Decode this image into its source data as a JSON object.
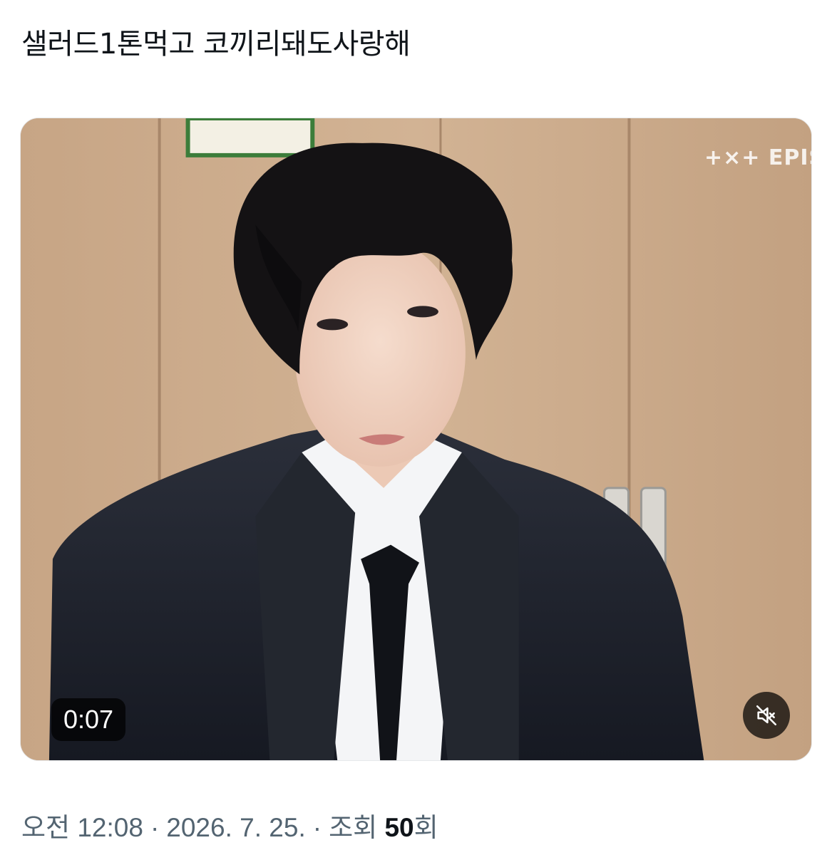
{
  "tweet": {
    "text": "샐러드1톤먹고 코끼리돼도사랑해"
  },
  "media": {
    "type": "video",
    "elapsed_time": "0:07",
    "watermark": "+×+ EPIS",
    "mute_icon": "speaker-muted-icon",
    "muted": true
  },
  "meta": {
    "time": "오전 12:08",
    "separator": "·",
    "date": "2026. 7. 25.",
    "views_label": "조회",
    "views_count": "50",
    "views_suffix": "회"
  }
}
